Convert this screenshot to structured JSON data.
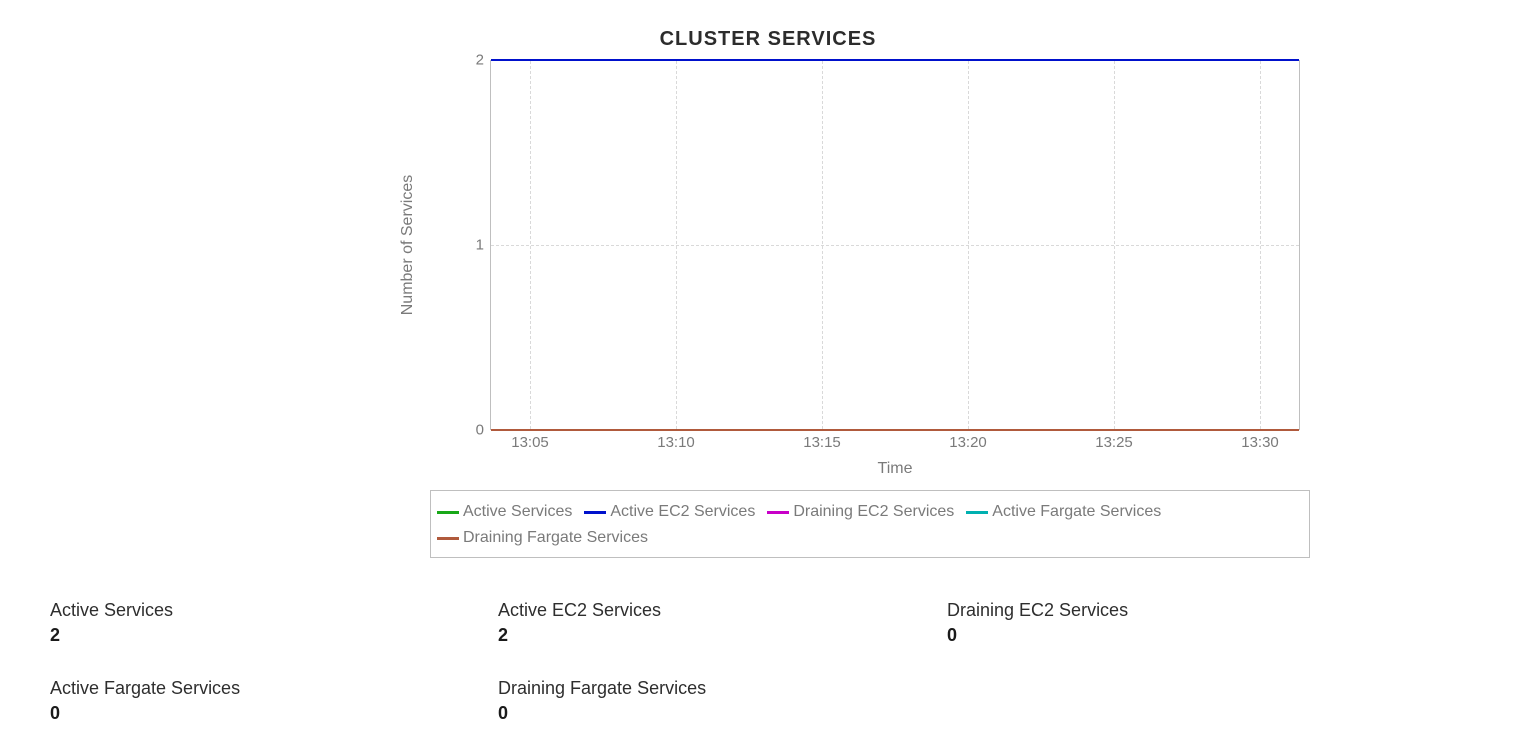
{
  "chart_data": {
    "type": "line",
    "title": "CLUSTER SERVICES",
    "xlabel": "Time",
    "ylabel": "Number of Services",
    "x_ticks": [
      "13:05",
      "13:10",
      "13:15",
      "13:20",
      "13:25",
      "13:30"
    ],
    "y_ticks": [
      0,
      1,
      2
    ],
    "ylim": [
      0,
      2
    ],
    "series": [
      {
        "name": "Active Services",
        "color": "#18a818",
        "values": [
          2,
          2,
          2,
          2,
          2,
          2
        ]
      },
      {
        "name": "Active EC2 Services",
        "color": "#0011cc",
        "values": [
          2,
          2,
          2,
          2,
          2,
          2
        ]
      },
      {
        "name": "Draining EC2 Services",
        "color": "#c800c8",
        "values": [
          0,
          0,
          0,
          0,
          0,
          0
        ]
      },
      {
        "name": "Active Fargate Services",
        "color": "#00b0b0",
        "values": [
          0,
          0,
          0,
          0,
          0,
          0
        ]
      },
      {
        "name": "Draining Fargate Services",
        "color": "#b05a3c",
        "values": [
          0,
          0,
          0,
          0,
          0,
          0
        ]
      }
    ]
  },
  "stats": [
    {
      "label": "Active Services",
      "value": "2"
    },
    {
      "label": "Active EC2 Services",
      "value": "2"
    },
    {
      "label": "Draining EC2 Services",
      "value": "0"
    },
    {
      "label": "Active Fargate Services",
      "value": "0"
    },
    {
      "label": "Draining Fargate Services",
      "value": "0"
    }
  ]
}
